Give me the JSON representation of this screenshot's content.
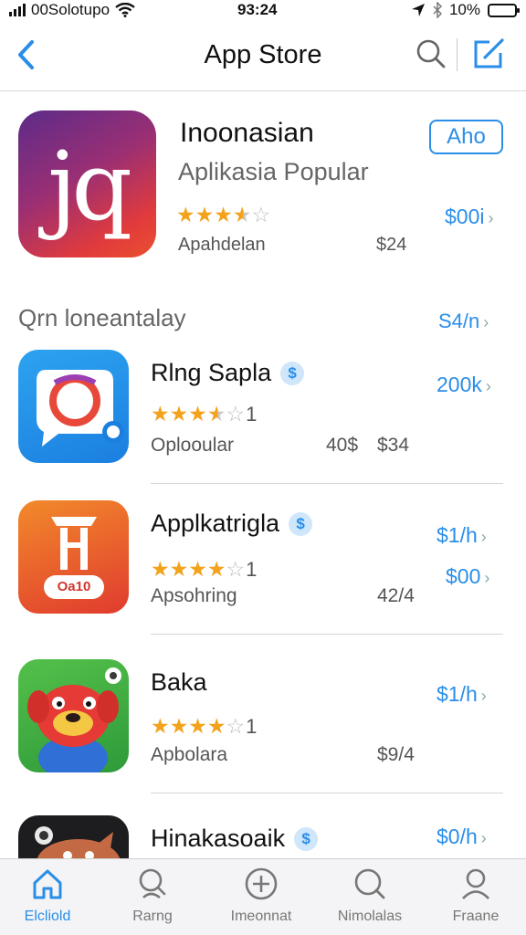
{
  "status_bar": {
    "carrier": "00Solotupo",
    "time": "93:24",
    "battery": "10%",
    "battery_level": 0.1
  },
  "nav": {
    "title": "App Store",
    "icons": [
      "chevron-left-icon",
      "search-icon",
      "compose-icon"
    ]
  },
  "featured": {
    "icon_glyph": "jq",
    "name": "Inoonasian",
    "subtitle": "Aplikasia Popular",
    "rating": 3.5,
    "developer": "Apahdelan",
    "size": "$24",
    "get_label": "Aho",
    "price": "$00i"
  },
  "section": {
    "title": "Qrn loneantalay",
    "link": "S4/n"
  },
  "apps": [
    {
      "name": "Rlng Sapla",
      "badge": "$",
      "rating": 3.5,
      "rating_count": "1",
      "subtitle": "Oplooular",
      "meta": "40$",
      "meta2": "$34",
      "price": "200k",
      "price2": ""
    },
    {
      "name": "Applkatrigla",
      "badge": "$",
      "rating": 4,
      "rating_count": "1",
      "subtitle": "Apsohring",
      "meta": "",
      "meta2": "42/4",
      "price": "$1/h",
      "price2": "$00",
      "icon_text": "Oa10"
    },
    {
      "name": "Baka",
      "badge": "",
      "rating": 4,
      "rating_count": "1",
      "subtitle": "Apbolara",
      "meta": "",
      "meta2": "$9/4",
      "price": "$1/h",
      "price2": ""
    },
    {
      "name": "Hinakasoaik",
      "badge": "$",
      "rating": 0,
      "rating_count": "",
      "subtitle": "",
      "meta": "",
      "meta2": "",
      "price": "$0/h",
      "price2": ""
    }
  ],
  "tabs": [
    {
      "label": "Elcliold",
      "icon": "home-icon",
      "active": true
    },
    {
      "label": "Rarng",
      "icon": "search-icon",
      "active": false
    },
    {
      "label": "Imeonnat",
      "icon": "plus-circle-icon",
      "active": false
    },
    {
      "label": "Nimolalas",
      "icon": "search-icon",
      "active": false
    },
    {
      "label": "Fraane",
      "icon": "person-icon",
      "active": false
    }
  ],
  "colors": {
    "accent": "#2a8ee8",
    "star": "#f3a21b"
  }
}
